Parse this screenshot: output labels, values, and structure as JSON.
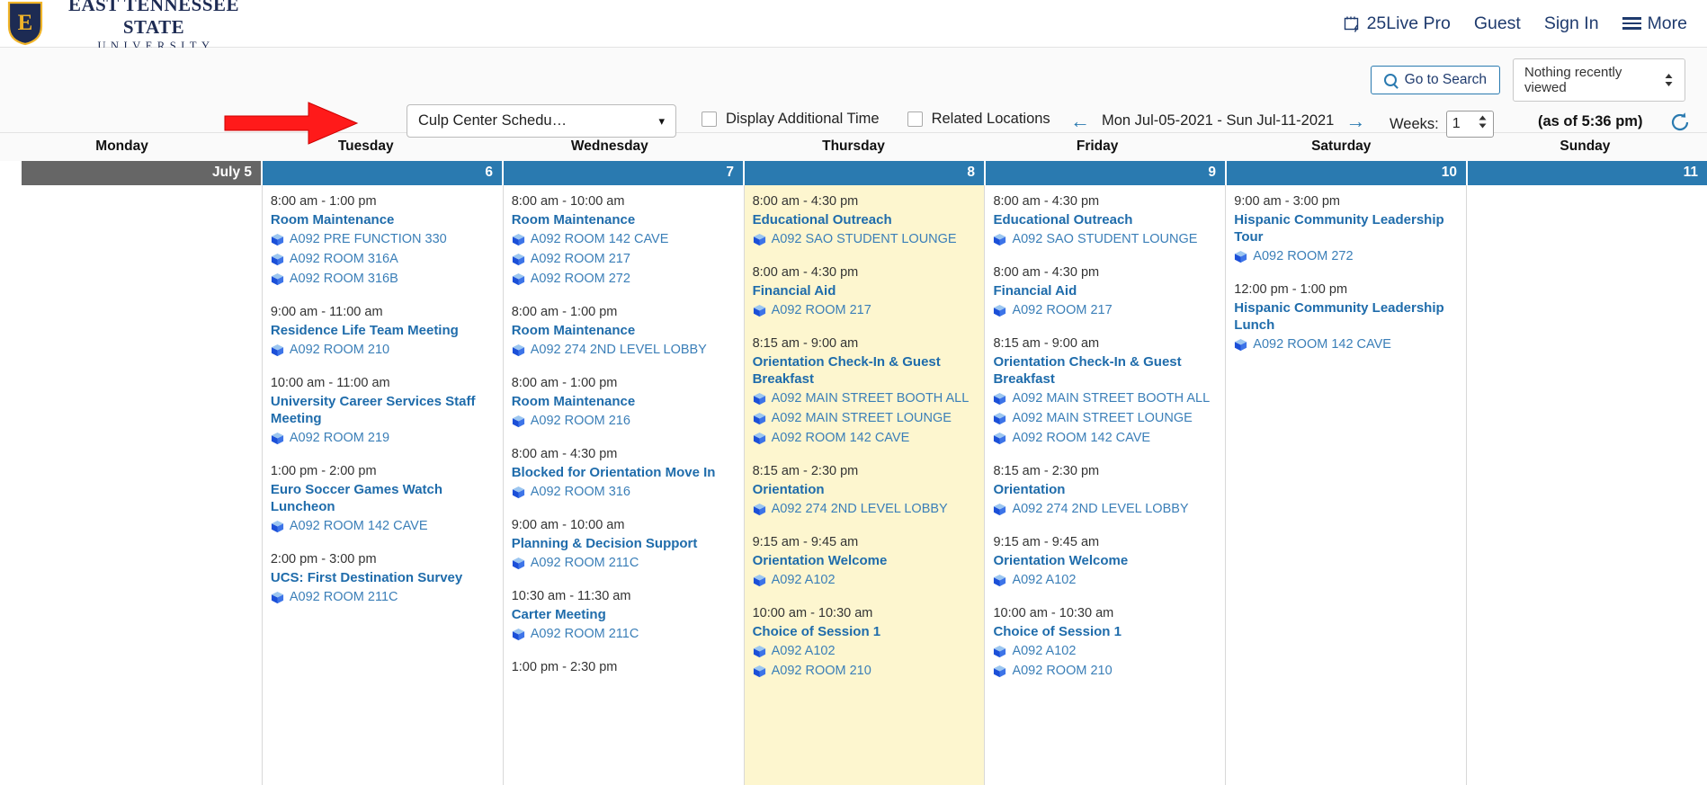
{
  "brand": {
    "name_main": "EAST TENNESSEE STATE",
    "name_sub": "UNIVERSITY",
    "shield_letter": "E"
  },
  "topnav": {
    "product": "25Live Pro",
    "guest": "Guest",
    "sign_in": "Sign In",
    "more": "More"
  },
  "toolbar": {
    "go_to_search": "Go to Search",
    "recently_viewed": "Nothing recently viewed",
    "schedule_select": "Culp Center Schedu…",
    "display_additional_time": "Display Additional Time",
    "related_locations": "Related Locations",
    "date_range": "Mon Jul-05-2021 - Sun Jul-11-2021",
    "weeks_label": "Weeks:",
    "weeks_value": "1",
    "as_of": "(as of 5:36 pm)"
  },
  "colors": {
    "brand_navy": "#1d2b53",
    "brand_gold": "#f0b429",
    "header_blue": "#2a7ab0",
    "header_gray": "#666666",
    "highlight_yellow": "#fdf6cf",
    "link_blue": "#1f6cab"
  },
  "calendar": {
    "daynames": [
      "Monday",
      "Tuesday",
      "Wednesday",
      "Thursday",
      "Friday",
      "Saturday",
      "Sunday"
    ],
    "days": [
      {
        "date_label": "July 5",
        "state": "past",
        "highlight": false,
        "events": []
      },
      {
        "date_label": "6",
        "state": "normal",
        "highlight": false,
        "events": [
          {
            "time": "8:00 am - 1:00 pm",
            "title": "Room Maintenance",
            "locations": [
              "A092 PRE FUNCTION 330",
              "A092 ROOM 316A",
              "A092 ROOM 316B"
            ]
          },
          {
            "time": "9:00 am - 11:00 am",
            "title": "Residence Life Team Meeting",
            "locations": [
              "A092 ROOM 210"
            ]
          },
          {
            "time": "10:00 am - 11:00 am",
            "title": "University Career Services Staff Meeting",
            "locations": [
              "A092 ROOM 219"
            ]
          },
          {
            "time": "1:00 pm - 2:00 pm",
            "title": "Euro Soccer Games Watch Luncheon",
            "locations": [
              "A092 ROOM 142 CAVE"
            ]
          },
          {
            "time": "2:00 pm - 3:00 pm",
            "title": "UCS: First Destination Survey",
            "locations": [
              "A092 ROOM 211C"
            ]
          }
        ]
      },
      {
        "date_label": "7",
        "state": "normal",
        "highlight": false,
        "events": [
          {
            "time": "8:00 am - 10:00 am",
            "title": "Room Maintenance",
            "locations": [
              "A092 ROOM 142 CAVE",
              "A092 ROOM 217",
              "A092 ROOM 272"
            ]
          },
          {
            "time": "8:00 am - 1:00 pm",
            "title": "Room Maintenance",
            "locations": [
              "A092 274 2ND LEVEL LOBBY"
            ]
          },
          {
            "time": "8:00 am - 1:00 pm",
            "title": "Room Maintenance",
            "locations": [
              "A092 ROOM 216"
            ]
          },
          {
            "time": "8:00 am - 4:30 pm",
            "title": "Blocked for Orientation Move In",
            "locations": [
              "A092 ROOM 316"
            ]
          },
          {
            "time": "9:00 am - 10:00 am",
            "title": "Planning & Decision Support",
            "locations": [
              "A092 ROOM 211C"
            ]
          },
          {
            "time": "10:30 am - 11:30 am",
            "title": "Carter Meeting",
            "locations": [
              "A092 ROOM 211C"
            ]
          },
          {
            "time": "1:00 pm - 2:30 pm",
            "title": "",
            "locations": []
          }
        ]
      },
      {
        "date_label": "8",
        "state": "normal",
        "highlight": true,
        "events": [
          {
            "time": "8:00 am - 4:30 pm",
            "title": "Educational Outreach",
            "locations": [
              "A092 SAO STUDENT LOUNGE"
            ]
          },
          {
            "time": "8:00 am - 4:30 pm",
            "title": "Financial Aid",
            "locations": [
              "A092 ROOM 217"
            ]
          },
          {
            "time": "8:15 am - 9:00 am",
            "title": "Orientation Check-In & Guest Breakfast",
            "locations": [
              "A092 MAIN STREET BOOTH ALL",
              "A092 MAIN STREET LOUNGE",
              "A092 ROOM 142 CAVE"
            ]
          },
          {
            "time": "8:15 am - 2:30 pm",
            "title": "Orientation",
            "locations": [
              "A092 274 2ND LEVEL LOBBY"
            ]
          },
          {
            "time": "9:15 am - 9:45 am",
            "title": "Orientation Welcome",
            "locations": [
              "A092 A102"
            ]
          },
          {
            "time": "10:00 am - 10:30 am",
            "title": "Choice of Session 1",
            "locations": [
              "A092 A102",
              "A092 ROOM 210"
            ]
          }
        ]
      },
      {
        "date_label": "9",
        "state": "normal",
        "highlight": false,
        "events": [
          {
            "time": "8:00 am - 4:30 pm",
            "title": "Educational Outreach",
            "locations": [
              "A092 SAO STUDENT LOUNGE"
            ]
          },
          {
            "time": "8:00 am - 4:30 pm",
            "title": "Financial Aid",
            "locations": [
              "A092 ROOM 217"
            ]
          },
          {
            "time": "8:15 am - 9:00 am",
            "title": "Orientation Check-In & Guest Breakfast",
            "locations": [
              "A092 MAIN STREET BOOTH ALL",
              "A092 MAIN STREET LOUNGE",
              "A092 ROOM 142 CAVE"
            ]
          },
          {
            "time": "8:15 am - 2:30 pm",
            "title": "Orientation",
            "locations": [
              "A092 274 2ND LEVEL LOBBY"
            ]
          },
          {
            "time": "9:15 am - 9:45 am",
            "title": "Orientation Welcome",
            "locations": [
              "A092 A102"
            ]
          },
          {
            "time": "10:00 am - 10:30 am",
            "title": "Choice of Session 1",
            "locations": [
              "A092 A102",
              "A092 ROOM 210"
            ]
          }
        ]
      },
      {
        "date_label": "10",
        "state": "normal",
        "highlight": false,
        "events": [
          {
            "time": "9:00 am - 3:00 pm",
            "title": "Hispanic Community Leadership Tour",
            "locations": [
              "A092 ROOM 272"
            ]
          },
          {
            "time": "12:00 pm - 1:00 pm",
            "title": "Hispanic Community Leadership Lunch",
            "locations": [
              "A092 ROOM 142 CAVE"
            ]
          }
        ]
      },
      {
        "date_label": "11",
        "state": "normal",
        "highlight": false,
        "events": []
      }
    ]
  },
  "annotation": {
    "arrow": "red-right-arrow pointing at schedule selector"
  }
}
